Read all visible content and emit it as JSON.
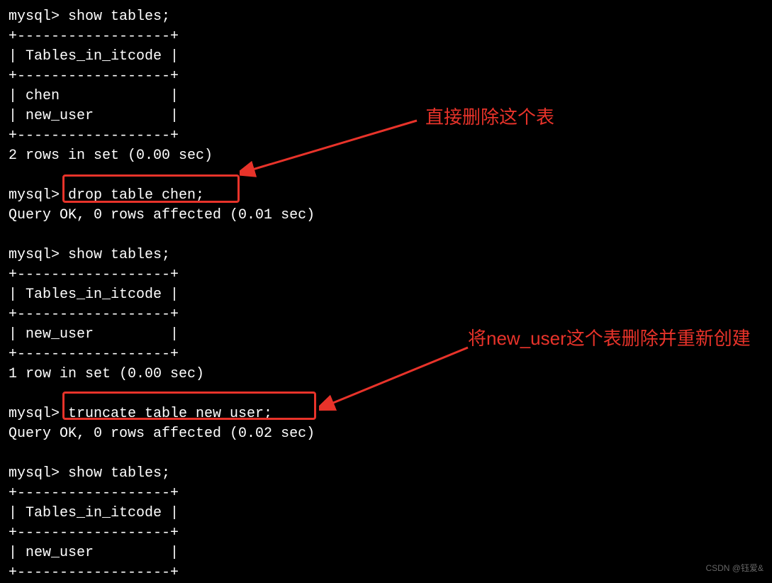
{
  "terminal": {
    "lines": [
      "mysql> show tables;",
      "+------------------+",
      "| Tables_in_itcode |",
      "+------------------+",
      "| chen             |",
      "| new_user         |",
      "+------------------+",
      "2 rows in set (0.00 sec)",
      "",
      "mysql> drop table chen;",
      "Query OK, 0 rows affected (0.01 sec)",
      "",
      "mysql> show tables;",
      "+------------------+",
      "| Tables_in_itcode |",
      "+------------------+",
      "| new_user         |",
      "+------------------+",
      "1 row in set (0.00 sec)",
      "",
      "mysql> truncate table new_user;",
      "Query OK, 0 rows affected (0.02 sec)",
      "",
      "mysql> show tables;",
      "+------------------+",
      "| Tables_in_itcode |",
      "+------------------+",
      "| new_user         |",
      "+------------------+"
    ]
  },
  "annotations": {
    "note1": "直接删除这个表",
    "note2": "将new_user这个表删除并重新创建"
  },
  "watermark": "CSDN @钰爱&",
  "colors": {
    "accent": "#e8332a",
    "bg": "#000000",
    "text": "#ffffff"
  }
}
